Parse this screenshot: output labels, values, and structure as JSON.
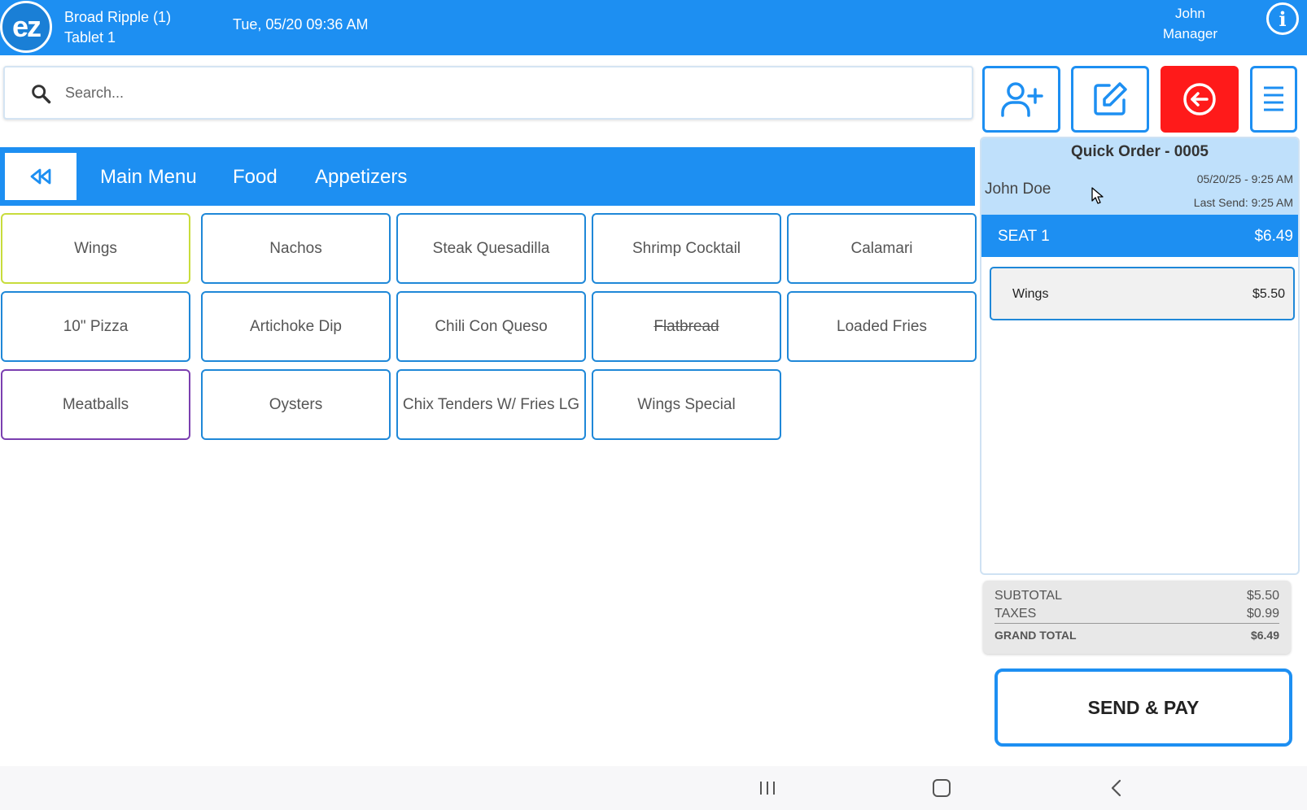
{
  "header": {
    "logo_text": "ez",
    "location": "Broad Ripple (1)",
    "device": "Tablet 1",
    "datetime": "Tue, 05/20 09:36 AM",
    "user_name": "John",
    "user_role": "Manager",
    "info_icon": "info-icon"
  },
  "search": {
    "placeholder": "Search...",
    "value": ""
  },
  "toolbar": {
    "icons": [
      "add-user-icon",
      "edit-icon",
      "back-arrow-icon",
      "menu-icon"
    ],
    "accent_color": "#1d8ff2",
    "exit_color": "#ff1a1a"
  },
  "breadcrumb": {
    "back_icon": "rewind-icon",
    "items": [
      "Main Menu",
      "Food",
      "Appetizers"
    ]
  },
  "menu_items": [
    {
      "label": "Wings",
      "border": "#c8dc3c"
    },
    {
      "label": "Nachos",
      "border": "#1f88d8"
    },
    {
      "label": "Steak Quesadilla",
      "border": "#1f88d8"
    },
    {
      "label": "Shrimp Cocktail",
      "border": "#1f88d8"
    },
    {
      "label": "Calamari",
      "border": "#1f88d8"
    },
    {
      "label": "10\" Pizza",
      "border": "#1f88d8"
    },
    {
      "label": "Artichoke Dip",
      "border": "#1f88d8"
    },
    {
      "label": "Chili Con Queso",
      "border": "#1f88d8"
    },
    {
      "label": "Flatbread",
      "border": "#1f88d8",
      "strikethrough": true
    },
    {
      "label": "Loaded Fries",
      "border": "#1f88d8"
    },
    {
      "label": "Meatballs",
      "border": "#7b3fb0"
    },
    {
      "label": "Oysters",
      "border": "#1f88d8"
    },
    {
      "label": "Chix Tenders W/ Fries LG",
      "border": "#1f88d8"
    },
    {
      "label": "Wings Special",
      "border": "#1f88d8"
    }
  ],
  "order": {
    "title": "Quick Order - 0005",
    "customer": "John Doe",
    "date": "05/20/25 - 9:25 AM",
    "last_send": "Last Send: 9:25 AM",
    "seat_label": "SEAT 1",
    "seat_amount": "$6.49",
    "line_items": [
      {
        "name": "Wings",
        "price": "$5.50"
      }
    ]
  },
  "totals": {
    "subtotal_label": "SUBTOTAL",
    "subtotal": "$5.50",
    "taxes_label": "TAXES",
    "taxes": "$0.99",
    "grand_label": "GRAND TOTAL",
    "grand": "$6.49"
  },
  "actions": {
    "send_pay": "SEND & PAY"
  },
  "navbar": {
    "icons": [
      "recent-apps-icon",
      "home-icon",
      "back-icon"
    ]
  }
}
